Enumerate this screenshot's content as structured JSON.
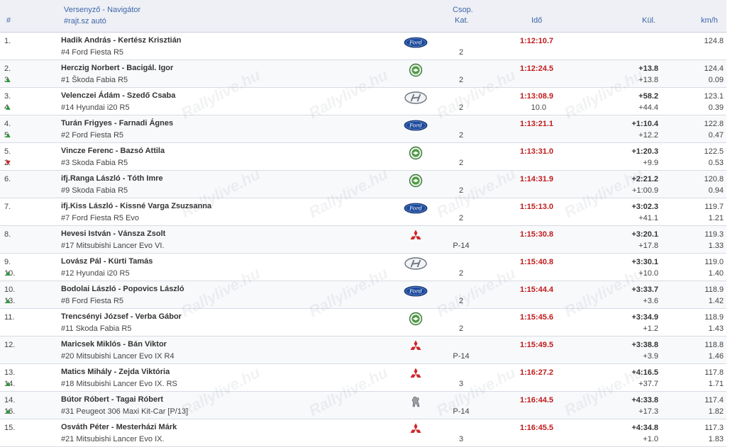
{
  "headers": {
    "num": "#",
    "driver": "Versenyző - Navigátor",
    "startcar": "#rajt.sz autó",
    "group": "Csop.",
    "category": "Kat.",
    "time": "Idő",
    "diff": "Kül.",
    "speed": "km/h"
  },
  "watermark": "Rallylive.hu",
  "rows": [
    {
      "pos": "1.",
      "prev": "",
      "move": "",
      "crew": "Hadik András - Kertész Krisztián",
      "car": "#4 Ford Fiesta R5",
      "brand": "ford",
      "grp": "2",
      "time": "1:12:10.7",
      "penalty": "",
      "diff_first": "",
      "diff_prev": "",
      "speed": "124.8",
      "speed_diff": ""
    },
    {
      "pos": "2.",
      "prev": "3.",
      "move": "up",
      "crew": "Herczig Norbert - Bacigál. Igor",
      "car": "#1 Škoda Fabia R5",
      "brand": "skoda",
      "grp": "2",
      "time": "1:12:24.5",
      "penalty": "",
      "diff_first": "+13.8",
      "diff_prev": "+13.8",
      "speed": "124.4",
      "speed_diff": "0.09"
    },
    {
      "pos": "3.",
      "prev": "4.",
      "move": "up",
      "crew": "Velenczei Ádám - Szedő Csaba",
      "car": "#14 Hyundai i20 R5",
      "brand": "hyundai",
      "grp": "2",
      "time": "1:13:08.9",
      "penalty": "10.0",
      "diff_first": "+58.2",
      "diff_prev": "+44.4",
      "speed": "123.1",
      "speed_diff": "0.39"
    },
    {
      "pos": "4.",
      "prev": "5.",
      "move": "up",
      "crew": "Turán Frigyes - Farnadi Ágnes",
      "car": "#2 Ford Fiesta R5",
      "brand": "ford",
      "grp": "2",
      "time": "1:13:21.1",
      "penalty": "",
      "diff_first": "+1:10.4",
      "diff_prev": "+12.2",
      "speed": "122.8",
      "speed_diff": "0.47"
    },
    {
      "pos": "5.",
      "prev": "2.",
      "move": "down",
      "crew": "Vincze Ferenc - Bazsó Attila",
      "car": "#3 Skoda Fabia R5",
      "brand": "skoda",
      "grp": "2",
      "time": "1:13:31.0",
      "penalty": "",
      "diff_first": "+1:20.3",
      "diff_prev": "+9.9",
      "speed": "122.5",
      "speed_diff": "0.53"
    },
    {
      "pos": "6.",
      "prev": "",
      "move": "",
      "crew": "ifj.Ranga László - Tóth Imre",
      "car": "#9 Skoda Fabia R5",
      "brand": "skoda",
      "grp": "2",
      "time": "1:14:31.9",
      "penalty": "",
      "diff_first": "+2:21.2",
      "diff_prev": "+1:00.9",
      "speed": "120.8",
      "speed_diff": "0.94"
    },
    {
      "pos": "7.",
      "prev": "",
      "move": "",
      "crew": "ifj.Kiss László - Kissné Varga Zsuzsanna",
      "car": "#7 Ford Fiesta R5 Evo",
      "brand": "ford",
      "grp": "2",
      "time": "1:15:13.0",
      "penalty": "",
      "diff_first": "+3:02.3",
      "diff_prev": "+41.1",
      "speed": "119.7",
      "speed_diff": "1.21"
    },
    {
      "pos": "8.",
      "prev": "",
      "move": "",
      "crew": "Hevesi István - Vánsza Zsolt",
      "car": "#17 Mitsubishi Lancer Evo VI.",
      "brand": "mitsubishi",
      "grp": "P-14",
      "time": "1:15:30.8",
      "penalty": "",
      "diff_first": "+3:20.1",
      "diff_prev": "+17.8",
      "speed": "119.3",
      "speed_diff": "1.33"
    },
    {
      "pos": "9.",
      "prev": "10.",
      "move": "up",
      "crew": "Lovász Pál - Kürti Tamás",
      "car": "#12 Hyundai i20 R5",
      "brand": "hyundai",
      "grp": "2",
      "time": "1:15:40.8",
      "penalty": "",
      "diff_first": "+3:30.1",
      "diff_prev": "+10.0",
      "speed": "119.0",
      "speed_diff": "1.40"
    },
    {
      "pos": "10.",
      "prev": "13.",
      "move": "up",
      "crew": "Bodolai László - Popovics László",
      "car": "#8 Ford Fiesta R5",
      "brand": "ford",
      "grp": "2",
      "time": "1:15:44.4",
      "penalty": "",
      "diff_first": "+3:33.7",
      "diff_prev": "+3.6",
      "speed": "118.9",
      "speed_diff": "1.42"
    },
    {
      "pos": "11.",
      "prev": "",
      "move": "",
      "crew": "Trencsényi József - Verba Gábor",
      "car": "#11 Skoda Fabia R5",
      "brand": "skoda",
      "grp": "2",
      "time": "1:15:45.6",
      "penalty": "",
      "diff_first": "+3:34.9",
      "diff_prev": "+1.2",
      "speed": "118.9",
      "speed_diff": "1.43"
    },
    {
      "pos": "12.",
      "prev": "",
      "move": "",
      "crew": "Maricsek Miklós - Bán Viktor",
      "car": "#20 Mitsubishi Lancer Evo IX R4",
      "brand": "mitsubishi",
      "grp": "P-14",
      "time": "1:15:49.5",
      "penalty": "",
      "diff_first": "+3:38.8",
      "diff_prev": "+3.9",
      "speed": "118.8",
      "speed_diff": "1.46"
    },
    {
      "pos": "13.",
      "prev": "14.",
      "move": "up",
      "crew": "Matics Mihály - Zejda Viktória",
      "car": "#18 Mitsubishi Lancer Evo IX. RS",
      "brand": "mitsubishi",
      "grp": "3",
      "time": "1:16:27.2",
      "penalty": "",
      "diff_first": "+4:16.5",
      "diff_prev": "+37.7",
      "speed": "117.8",
      "speed_diff": "1.71"
    },
    {
      "pos": "14.",
      "prev": "16.",
      "move": "up",
      "crew": "Bútor Róbert - Tagai Róbert",
      "car": "#31 Peugeot 306 Maxi Kit-Car [P/13]",
      "brand": "peugeot",
      "grp": "P-14",
      "time": "1:16:44.5",
      "penalty": "",
      "diff_first": "+4:33.8",
      "diff_prev": "+17.3",
      "speed": "117.4",
      "speed_diff": "1.82"
    },
    {
      "pos": "15.",
      "prev": "",
      "move": "",
      "crew": "Osváth Péter - Mesterházi Márk",
      "car": "#21 Mitsubishi Lancer Evo IX.",
      "brand": "mitsubishi",
      "grp": "3",
      "time": "1:16:45.5",
      "penalty": "",
      "diff_first": "+4:34.8",
      "diff_prev": "+1.0",
      "speed": "117.3",
      "speed_diff": "1.83"
    }
  ]
}
